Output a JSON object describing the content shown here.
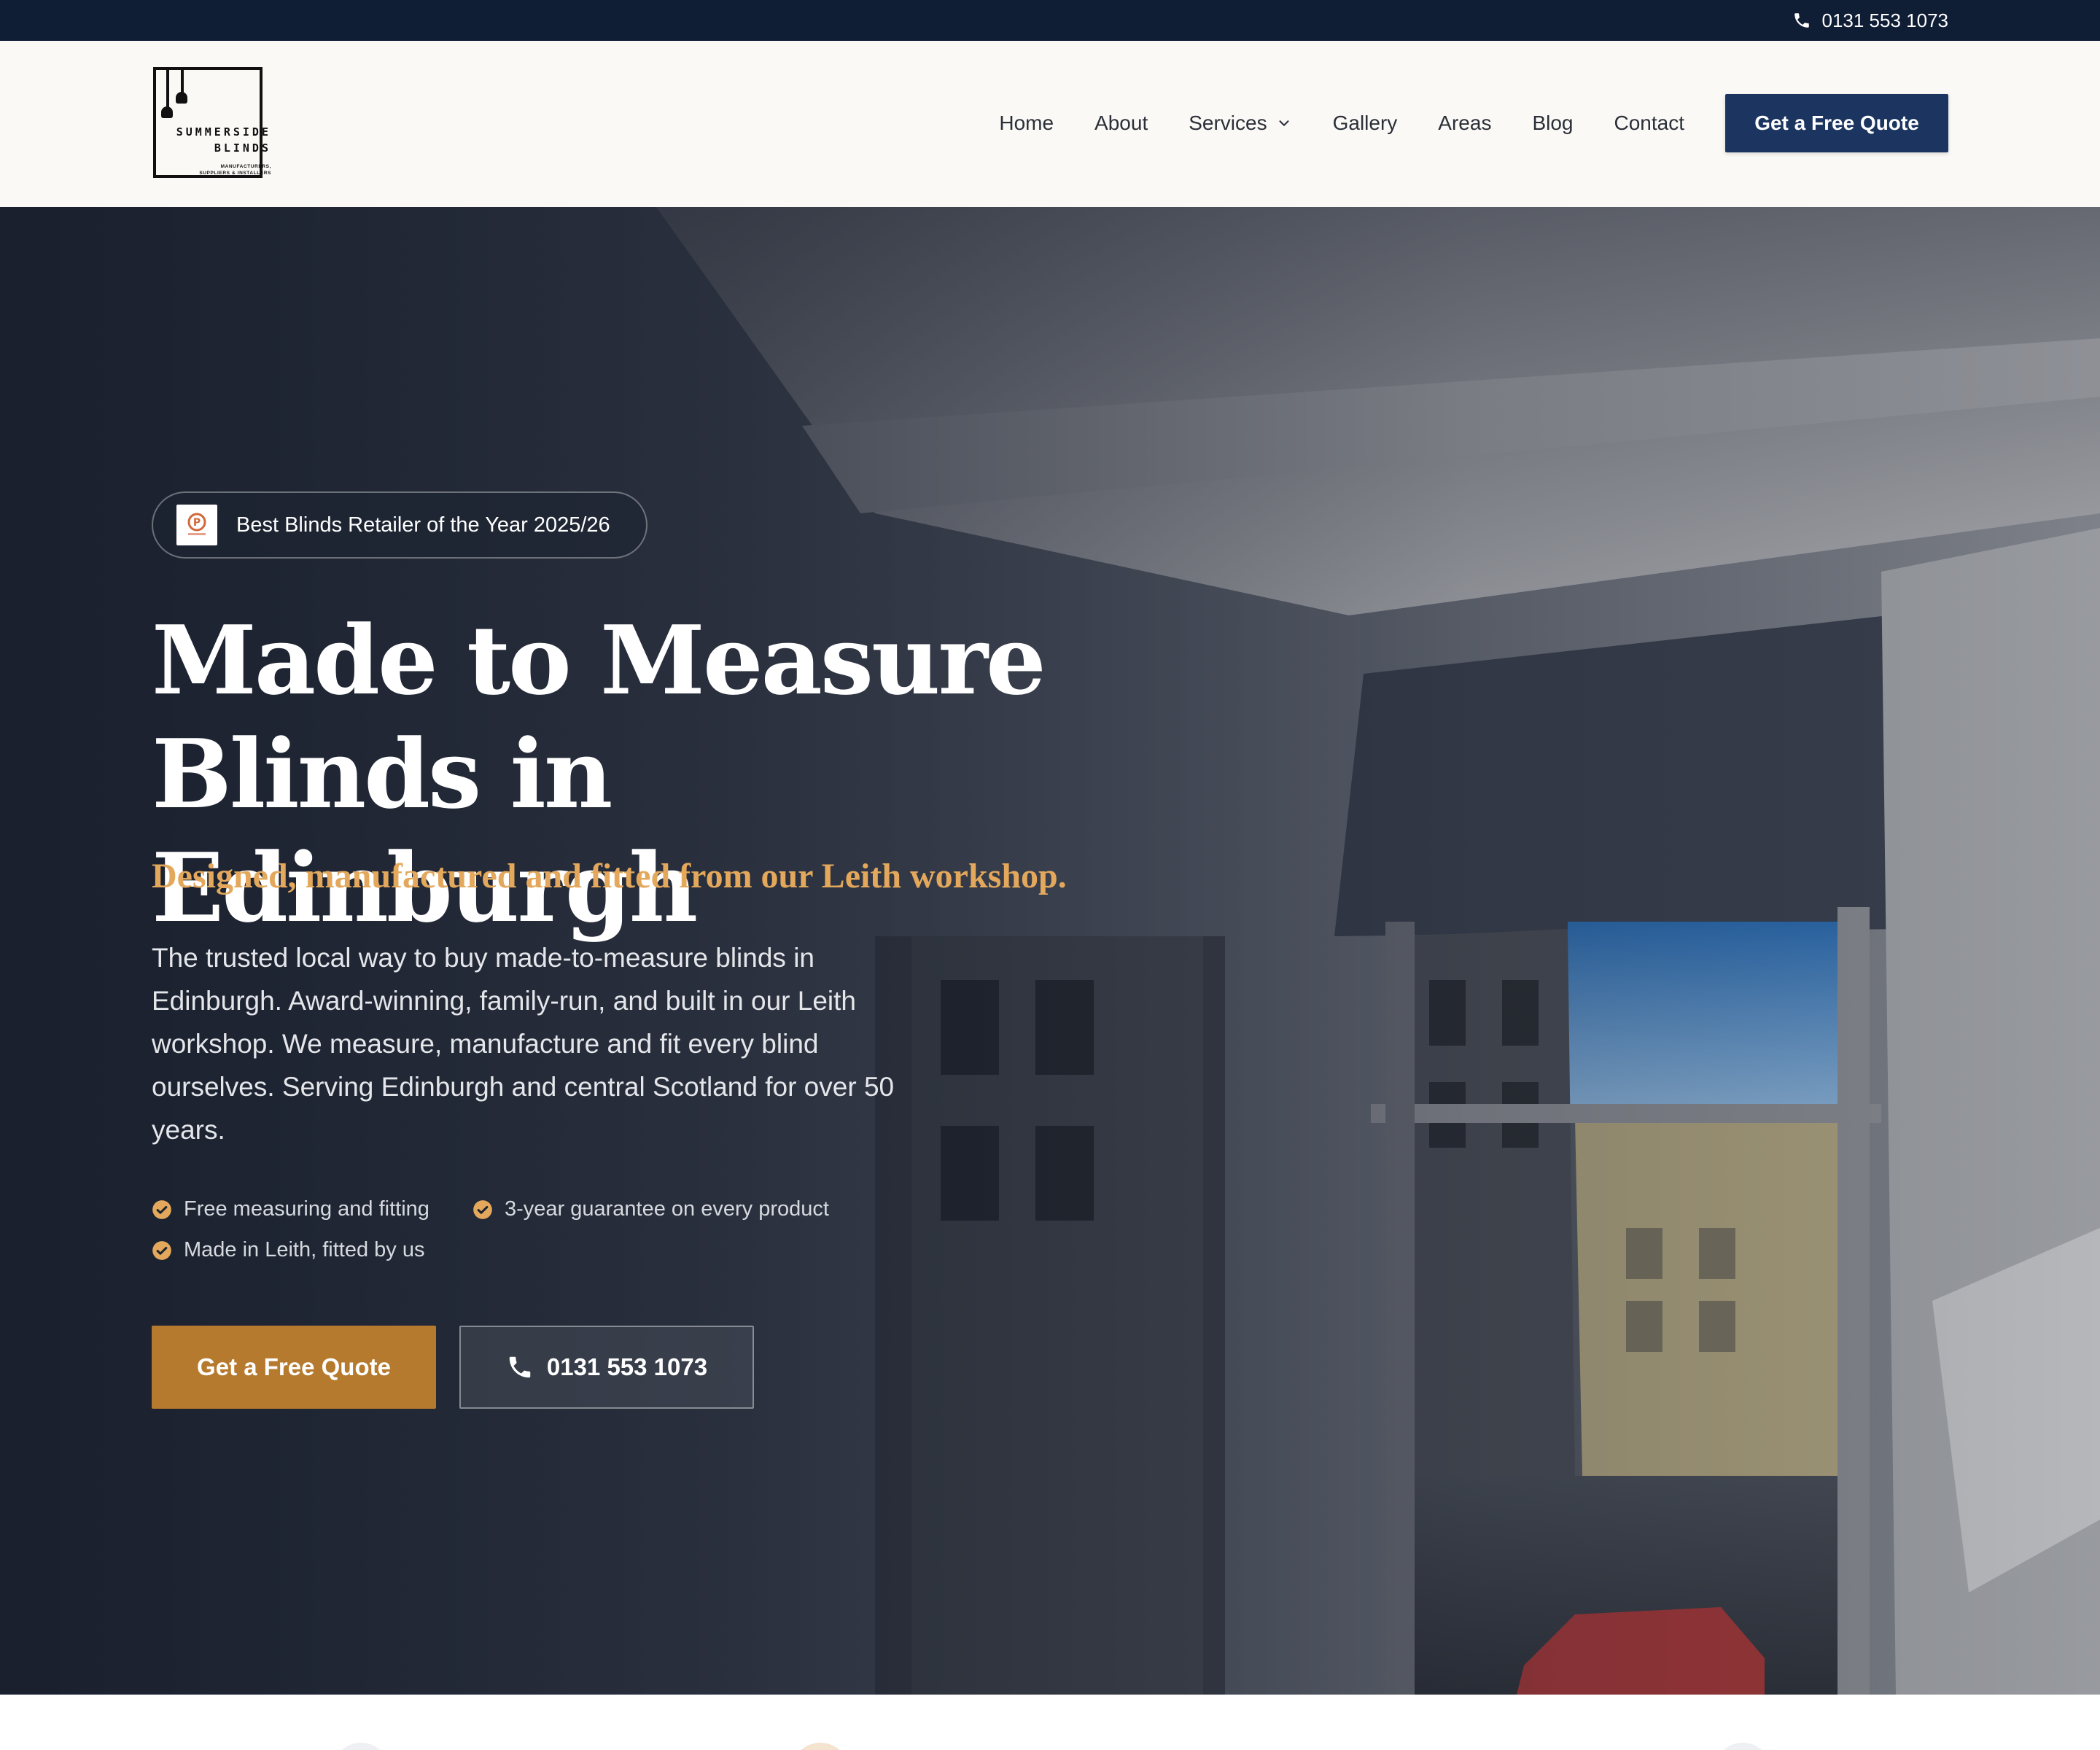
{
  "topbar": {
    "phone": "0131 553 1073",
    "phone_icon": "phone-icon"
  },
  "header": {
    "logo": {
      "name_line1": "SUMMERSIDE",
      "name_line2": "BLINDS",
      "tagline_line1": "MANUFACTURERS,",
      "tagline_line2": "SUPPLIERS & INSTALLERS"
    },
    "nav": [
      {
        "label": "Home"
      },
      {
        "label": "About"
      },
      {
        "label": "Services",
        "icon": "chevron-down-icon"
      },
      {
        "label": "Gallery"
      },
      {
        "label": "Areas"
      },
      {
        "label": "Blog"
      },
      {
        "label": "Contact"
      }
    ],
    "cta_label": "Get a Free Quote"
  },
  "hero": {
    "award_badge": "Best Blinds Retailer of the Year 2025/26",
    "title_line1": "Made to Measure",
    "title_line2": "Blinds in Edinburgh",
    "subtitle": "Designed, manufactured and fitted from our Leith workshop.",
    "body": "The trusted local way to buy made-to-measure blinds in Edinburgh. Award-winning, family-run, and built in our Leith workshop. We measure, manufacture and fit every blind ourselves. Serving Edinburgh and central Scotland for over 50 years.",
    "features": [
      "Free measuring and fitting",
      "3-year guarantee on every product",
      "Made in Leith, fitted by us"
    ],
    "primary_button": "Get a Free Quote",
    "secondary_button": "0131 553 1073"
  },
  "colors": {
    "topbar": "#0f1d35",
    "nav_cta": "#1c3560",
    "accent_gold": "#e3a85c",
    "primary_button": "#b67a2e"
  }
}
